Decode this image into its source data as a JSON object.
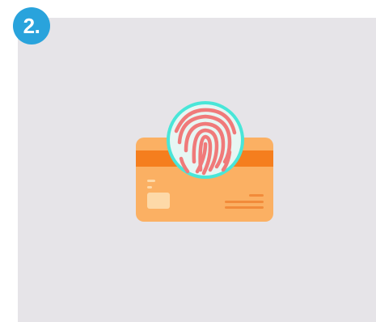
{
  "step": {
    "label": "2."
  },
  "illustration": {
    "icon": "fingerprint-card-icon",
    "colors": {
      "card_body": "#fbb063",
      "card_stripe": "#f57e1e",
      "card_chip": "#fdd9a8",
      "fingerprint_circle": "#49e6d8",
      "fingerprint_lines": "#f07a7a",
      "card_lines": "#f28b3a",
      "badge": "#29a3dc",
      "panel_background": "#e6e4e8"
    }
  }
}
